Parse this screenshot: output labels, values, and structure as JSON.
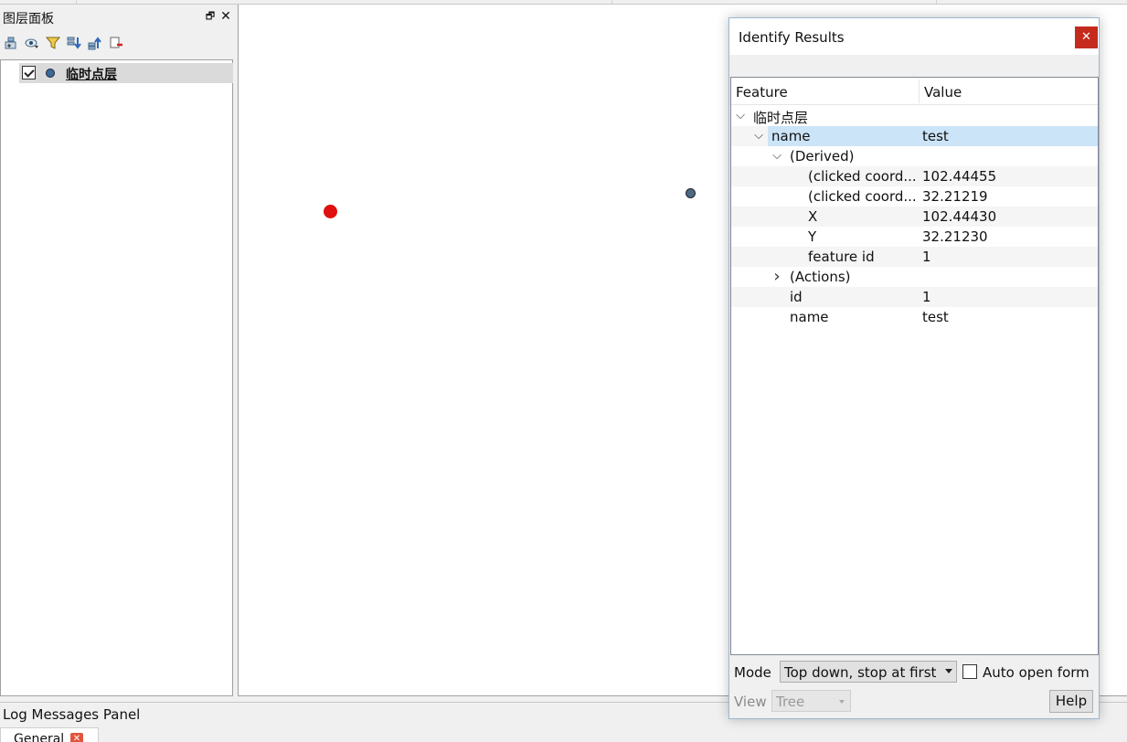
{
  "layers_panel": {
    "title": "图层面板",
    "float_glyph": "🗗",
    "close_glyph": "✕",
    "toolbar": [
      "add-group-icon",
      "manage-visibility-icon",
      "filter-icon",
      "expand-all-icon",
      "collapse-all-icon",
      "remove-layer-icon"
    ],
    "layers": [
      {
        "name": "临时点层",
        "checked": true,
        "color": "#3b6b95"
      }
    ]
  },
  "identify": {
    "title": "Identify Results",
    "close_glyph": "✕",
    "header": {
      "feature": "Feature",
      "value": "Value"
    },
    "rows": [
      {
        "feature": "临时点层",
        "value": "",
        "indent": 0,
        "expander": "open"
      },
      {
        "feature": "name",
        "value": "test",
        "indent": 1,
        "expander": "open",
        "selected": true
      },
      {
        "feature": "(Derived)",
        "value": "",
        "indent": 2,
        "expander": "open"
      },
      {
        "feature": "(clicked coord...",
        "value": "102.44455",
        "indent": 3,
        "expander": "none"
      },
      {
        "feature": "(clicked coord...",
        "value": "32.21219",
        "indent": 3,
        "expander": "none"
      },
      {
        "feature": "X",
        "value": "102.44430",
        "indent": 3,
        "expander": "none"
      },
      {
        "feature": "Y",
        "value": "32.21230",
        "indent": 3,
        "expander": "none"
      },
      {
        "feature": "feature id",
        "value": "1",
        "indent": 3,
        "expander": "none"
      },
      {
        "feature": "(Actions)",
        "value": "",
        "indent": 2,
        "expander": "closed"
      },
      {
        "feature": "id",
        "value": "1",
        "indent": 2,
        "expander": "none"
      },
      {
        "feature": "name",
        "value": "test",
        "indent": 2,
        "expander": "none"
      }
    ],
    "mode_label": "Mode",
    "mode_value": "Top down, stop at first",
    "auto_open_label": "Auto open form",
    "auto_open_checked": false,
    "view_label": "View",
    "view_value": "Tree",
    "help_label": "Help"
  },
  "log_panel": {
    "title": "Log Messages Panel",
    "tab": "General",
    "tab_close_glyph": "✕"
  },
  "map": {
    "points": [
      {
        "name": "clicked-point",
        "color": "#e01010"
      },
      {
        "name": "feature-point",
        "color": "#4d6a80"
      }
    ]
  }
}
